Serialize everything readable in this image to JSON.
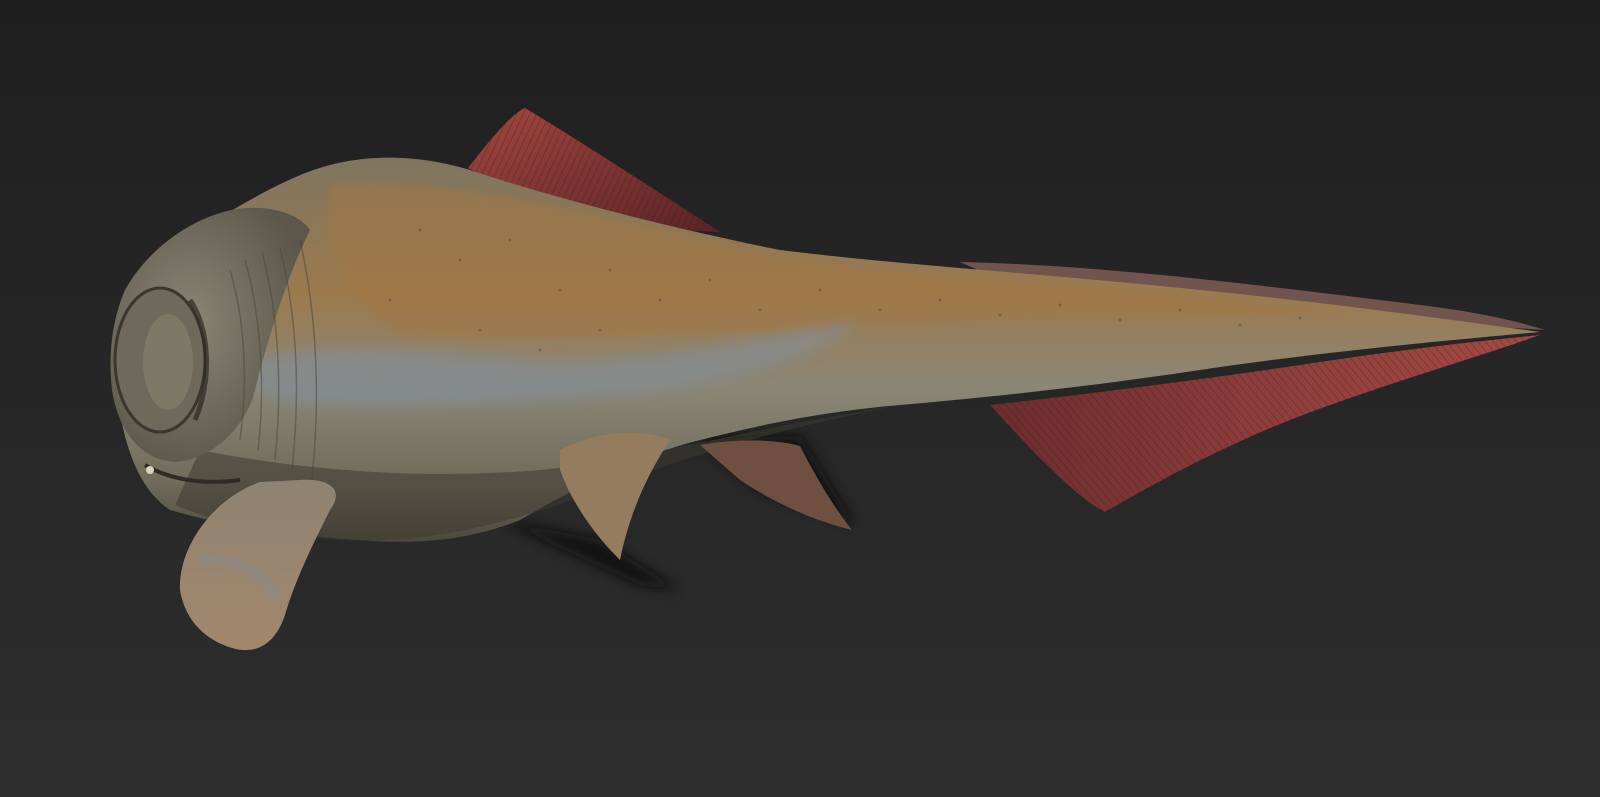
{
  "scene": {
    "subject_icon": "prehistoric-fish-render",
    "colors": {
      "background_top": "#1f1f1f",
      "background_bottom": "#2e2e2e",
      "body_base": "#8a7a5f",
      "body_orange": "#a67a4a",
      "body_blue": "#7d8ea0",
      "body_shadow": "#5a5446",
      "fin_red": "#8a3a3a",
      "fin_dark": "#4a1f22",
      "cast_shadow": "#101010"
    }
  }
}
